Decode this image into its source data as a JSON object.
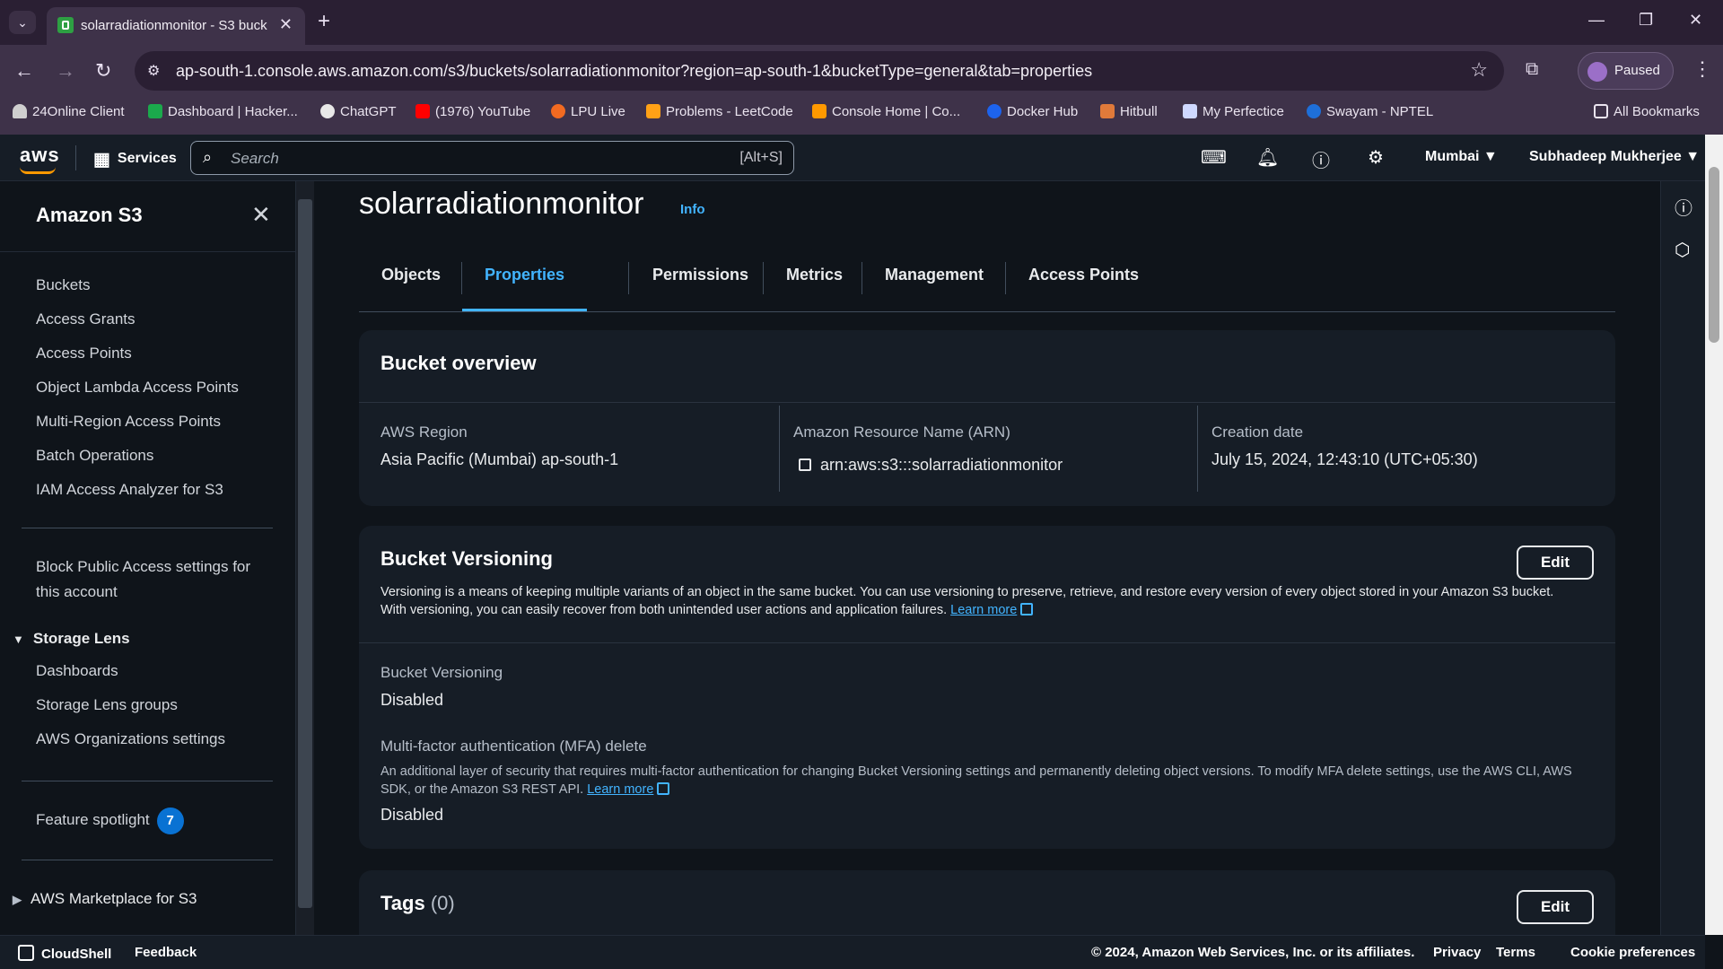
{
  "browser": {
    "tab_title": "solarradiationmonitor - S3 buck",
    "url": "ap-south-1.console.aws.amazon.com/s3/buckets/solarradiationmonitor?region=ap-south-1&bucketType=general&tab=properties",
    "profile_label": "Paused",
    "bookmarks": [
      {
        "label": "24Online Client",
        "color": "#d9d9d9"
      },
      {
        "label": "Dashboard | Hacker...",
        "color": "#1ba94c"
      },
      {
        "label": "ChatGPT",
        "color": "#e8e8e8"
      },
      {
        "label": "(1976) YouTube",
        "color": "#ff0000"
      },
      {
        "label": "LPU Live",
        "color": "#f26a21"
      },
      {
        "label": "Problems - LeetCode",
        "color": "#ffa116"
      },
      {
        "label": "Console Home | Co...",
        "color": "#ff9900"
      },
      {
        "label": "Docker Hub",
        "color": "#1d63ed"
      },
      {
        "label": "Hitbull",
        "color": "#e07a3a"
      },
      {
        "label": "My Perfectice",
        "color": "#cfd8ff"
      },
      {
        "label": "Swayam - NPTEL",
        "color": "#1e6fd9"
      }
    ],
    "all_bookmarks": "All Bookmarks"
  },
  "aws_header": {
    "logo": "aws",
    "services": "Services",
    "search_placeholder": "Search",
    "search_shortcut": "[Alt+S]",
    "region": "Mumbai ▼",
    "user": "Subhadeep Mukherjee ▼"
  },
  "sidenav": {
    "title": "Amazon S3",
    "items": [
      "Buckets",
      "Access Grants",
      "Access Points",
      "Object Lambda Access Points",
      "Multi-Region Access Points",
      "Batch Operations",
      "IAM Access Analyzer for S3"
    ],
    "block_public_line1": "Block Public Access settings for",
    "block_public_line2": "this account",
    "storage_lens": "Storage Lens",
    "storage_lens_items": [
      "Dashboards",
      "Storage Lens groups",
      "AWS Organizations settings"
    ],
    "feature_spotlight": "Feature spotlight",
    "feature_spotlight_count": "7",
    "marketplace": "AWS Marketplace for S3"
  },
  "main": {
    "bucket_name": "solarradiationmonitor",
    "info": "Info",
    "tabs": [
      "Objects",
      "Properties",
      "Permissions",
      "Metrics",
      "Management",
      "Access Points"
    ],
    "active_tab": "Properties",
    "overview": {
      "title": "Bucket overview",
      "region_label": "AWS Region",
      "region_value": "Asia Pacific (Mumbai) ap-south-1",
      "arn_label": "Amazon Resource Name (ARN)",
      "arn_value": "arn:aws:s3:::solarradiationmonitor",
      "created_label": "Creation date",
      "created_value": "July 15, 2024, 12:43:10 (UTC+05:30)"
    },
    "versioning": {
      "title": "Bucket Versioning",
      "edit": "Edit",
      "description": "Versioning is a means of keeping multiple variants of an object in the same bucket. You can use versioning to preserve, retrieve, and restore every version of every object stored in your Amazon S3 bucket. With versioning, you can easily recover from both unintended user actions and application failures.",
      "learn_more": "Learn more",
      "status_label": "Bucket Versioning",
      "status_value": "Disabled",
      "mfa_label": "Multi-factor authentication (MFA) delete",
      "mfa_description": "An additional layer of security that requires multi-factor authentication for changing Bucket Versioning settings and permanently deleting object versions. To modify MFA delete settings, use the AWS CLI, AWS SDK, or the Amazon S3 REST API.",
      "mfa_learn_more": "Learn more",
      "mfa_value": "Disabled"
    },
    "tags": {
      "title": "Tags",
      "count": "(0)",
      "edit": "Edit"
    }
  },
  "footer": {
    "cloudshell": "CloudShell",
    "feedback": "Feedback",
    "copyright": "© 2024, Amazon Web Services, Inc. or its affiliates.",
    "privacy": "Privacy",
    "terms": "Terms",
    "cookies": "Cookie preferences"
  }
}
